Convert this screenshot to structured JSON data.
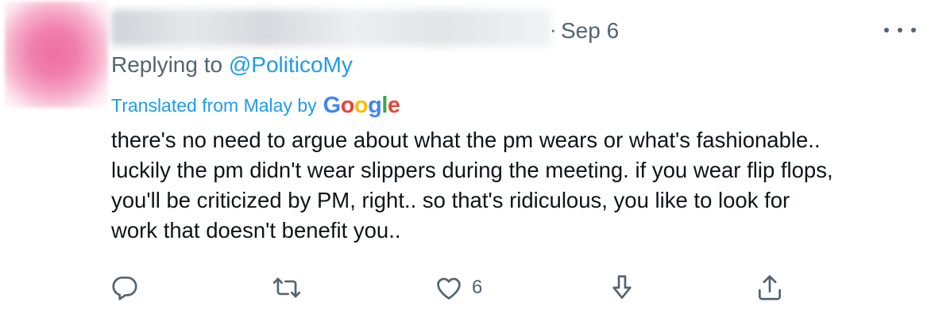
{
  "tweet": {
    "date": "Sep 6",
    "dot": "·",
    "replying_prefix": "Replying to",
    "replying_handle": "@PoliticoMy",
    "translated_label": "Translated from Malay by",
    "google_letters": [
      "G",
      "o",
      "o",
      "g",
      "l",
      "e"
    ],
    "google_colors": [
      "#4285F4",
      "#EA4335",
      "#FBBC05",
      "#4285F4",
      "#34A853",
      "#EA4335"
    ],
    "text_lines": [
      "there's no need to argue about what the pm wears or what's fashionable..",
      "luckily the pm didn't wear slippers during the meeting. if you wear flip flops,",
      "you'll be criticized by PM, right.. so that's ridiculous, you like to look for",
      "work that doesn't benefit you.."
    ],
    "like_count": "6"
  },
  "icons": {
    "avatar": "blurred-pink-avatar",
    "more": "ellipsis-icon",
    "reply": "reply-icon",
    "retweet": "retweet-icon",
    "like": "heart-icon",
    "share_down": "download-arrow-icon",
    "share_up": "share-icon"
  },
  "colors": {
    "secondary_text": "#536471",
    "link": "#1d9bf0",
    "primary_text": "#0f1419"
  }
}
